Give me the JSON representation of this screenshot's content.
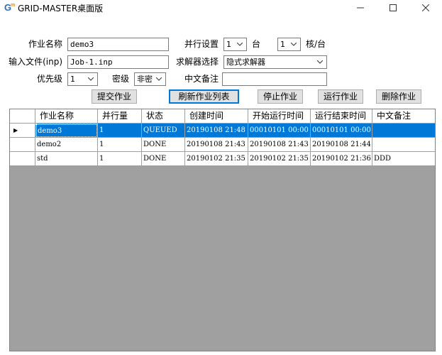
{
  "window": {
    "title": "GRID-MASTER桌面版",
    "logo_letters": "Gm",
    "controls": {
      "minimize": "—",
      "maximize": "☐",
      "close": "✕"
    }
  },
  "form": {
    "job_name_label": "作业名称",
    "job_name_value": "demo3",
    "input_file_label": "输入文件(inp)",
    "input_file_value": "Job-1.inp",
    "priority_label": "优先级",
    "priority_value": "1",
    "security_label": "密级",
    "security_value": "非密",
    "parallel_label": "并行设置",
    "parallel_nodes_value": "1",
    "nodes_unit": "台",
    "parallel_cores_value": "1",
    "cores_unit": "核/台",
    "solver_label": "求解器选择",
    "solver_value": "隐式求解器",
    "remark_label": "中文备注",
    "remark_value": ""
  },
  "buttons": {
    "submit": "提交作业",
    "refresh": "刷新作业列表",
    "stop": "停止作业",
    "run": "运行作业",
    "delete": "删除作业"
  },
  "grid": {
    "columns": [
      "作业名称",
      "并行量",
      "状态",
      "创建时间",
      "开始运行时间",
      "运行结束时间",
      "中文备注"
    ],
    "rows": [
      [
        "demo3",
        "1",
        "QUEUED",
        "20190108 21:48",
        "00010101 00:00",
        "00010101 00:00",
        ""
      ],
      [
        "demo2",
        "1",
        "DONE",
        "20190108 21:43",
        "20190108 21:43",
        "20190108 21:44",
        ""
      ],
      [
        "std",
        "1",
        "DONE",
        "20190102 21:35",
        "20190102 21:35",
        "20190102 21:36",
        "DDD"
      ]
    ],
    "selected_row": 0,
    "row_indicator": "▶"
  }
}
